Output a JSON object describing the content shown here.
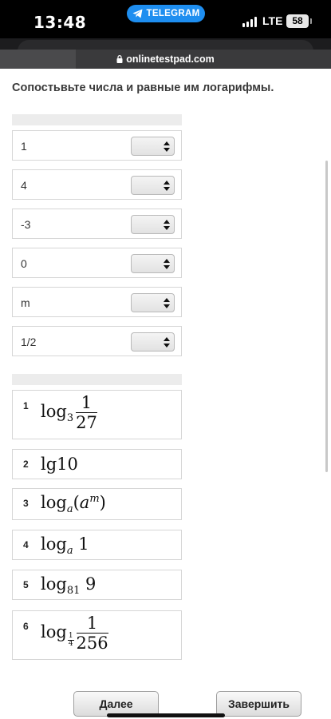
{
  "status_bar": {
    "time": "13:48",
    "telegram_label": "TELEGRAM",
    "network": "LTE",
    "battery": "58"
  },
  "browser": {
    "url": "onlinetestpad.com"
  },
  "question": {
    "text": "Сопостьвьте числа и равные им логарифмы."
  },
  "numbers": [
    {
      "value": "1",
      "selected": ""
    },
    {
      "value": "4",
      "selected": ""
    },
    {
      "value": "-3",
      "selected": ""
    },
    {
      "value": "0",
      "selected": ""
    },
    {
      "value": "m",
      "selected": ""
    },
    {
      "value": "1/2",
      "selected": ""
    }
  ],
  "formulas": [
    {
      "num": "1",
      "base": "3",
      "numerator": "1",
      "denominator": "27"
    },
    {
      "num": "2",
      "text": "lg10"
    },
    {
      "num": "3",
      "base": "a",
      "arg": "a",
      "exp": "m"
    },
    {
      "num": "4",
      "base": "a",
      "arg": "1"
    },
    {
      "num": "5",
      "base": "81",
      "arg": "9"
    },
    {
      "num": "6",
      "base_num": "1",
      "base_den": "4",
      "numerator": "1",
      "denominator": "256"
    }
  ],
  "buttons": {
    "next": "Далее",
    "finish": "Завершить"
  },
  "colors": {
    "telegram": "#1e8ef0",
    "border": "#d6d6d6",
    "header_band": "#ececec"
  }
}
